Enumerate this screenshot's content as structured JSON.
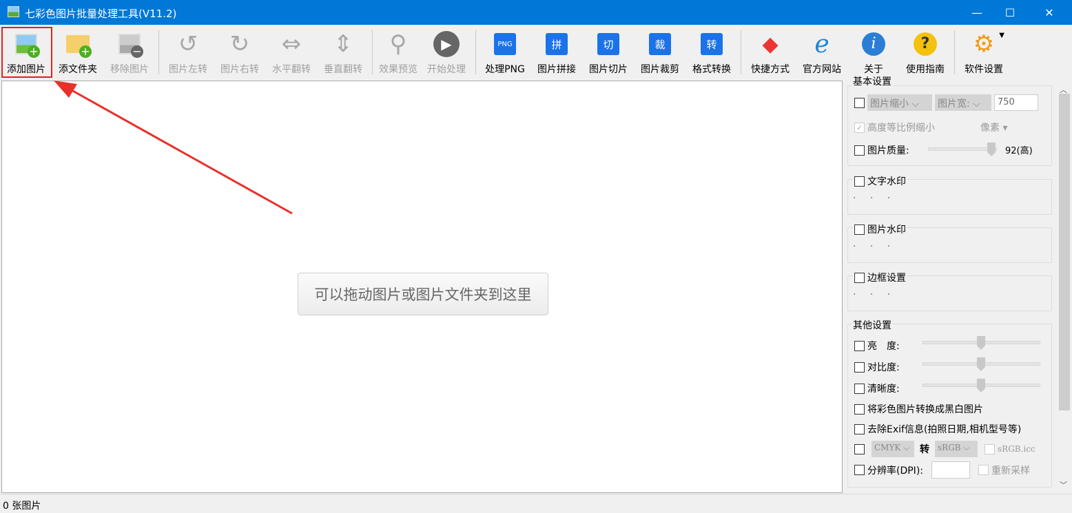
{
  "window": {
    "title": "七彩色图片批量处理工具(V11.2)",
    "minimize": "—",
    "maximize": "☐",
    "close": "✕"
  },
  "toolbar": [
    {
      "label": "添加图片",
      "icon": "add-image-icon",
      "enabled": true
    },
    {
      "label": "添文件夹",
      "icon": "add-folder-icon",
      "enabled": true
    },
    {
      "label": "移除图片",
      "icon": "remove-image-icon",
      "enabled": false
    },
    {
      "label": "图片左转",
      "icon": "rotate-left-icon",
      "enabled": false
    },
    {
      "label": "图片右转",
      "icon": "rotate-right-icon",
      "enabled": false
    },
    {
      "label": "水平翻转",
      "icon": "flip-horizontal-icon",
      "enabled": false
    },
    {
      "label": "垂直翻转",
      "icon": "flip-vertical-icon",
      "enabled": false
    },
    {
      "label": "效果预览",
      "icon": "magnifier-icon",
      "enabled": false
    },
    {
      "label": "开始处理",
      "icon": "play-icon",
      "enabled": false
    },
    {
      "label": "处理PNG",
      "icon": "png-icon",
      "icon_text": "PNG",
      "enabled": true
    },
    {
      "label": "图片拼接",
      "icon": "stitch-icon",
      "icon_text": "拼",
      "enabled": true
    },
    {
      "label": "图片切片",
      "icon": "slice-icon",
      "icon_text": "切",
      "enabled": true
    },
    {
      "label": "图片裁剪",
      "icon": "crop-icon",
      "icon_text": "裁",
      "enabled": true
    },
    {
      "label": "格式转换",
      "icon": "convert-icon",
      "icon_text": "转",
      "enabled": true
    },
    {
      "label": "快捷方式",
      "icon": "shortcut-cubes-icon",
      "enabled": true
    },
    {
      "label": "官方网站",
      "icon": "ie-browser-icon",
      "enabled": true
    },
    {
      "label": "关于",
      "icon": "info-icon",
      "enabled": true
    },
    {
      "label": "使用指南",
      "icon": "help-icon",
      "enabled": true
    },
    {
      "label": "软件设置",
      "icon": "gear-icon",
      "enabled": true
    }
  ],
  "main": {
    "drop_hint": "可以拖动图片或图片文件夹到这里"
  },
  "status": {
    "count": "0 张图片"
  },
  "panel": {
    "basic": {
      "title": "基本设置",
      "resize_mode": "图片缩小",
      "dimension": "图片宽:",
      "width_value": "750",
      "keep_ratio": "高度等比例缩小",
      "unit": "像素",
      "quality_label": "图片质量:",
      "quality_value": 92,
      "quality_text": "92(高)"
    },
    "text_watermark": {
      "title": "文字水印",
      "more": "· · ·"
    },
    "image_watermark": {
      "title": "图片水印",
      "more": "· · ·"
    },
    "border": {
      "title": "边框设置",
      "more": "· · ·"
    },
    "other": {
      "title": "其他设置",
      "brightness": "亮　度:",
      "contrast": "对比度:",
      "sharpness": "清晰度:",
      "brightness_value": 0.5,
      "grayscale": "将彩色图片转换成黑白图片",
      "remove_exif": "去除Exif信息(拍照日期,相机型号等)",
      "from_color": "CMYK",
      "to_label": "转",
      "to_color": "sRGB",
      "icc": "sRGB.icc",
      "dpi_label": "分辨率(DPI):",
      "dpi_value": "",
      "resample": "重新采样"
    }
  }
}
